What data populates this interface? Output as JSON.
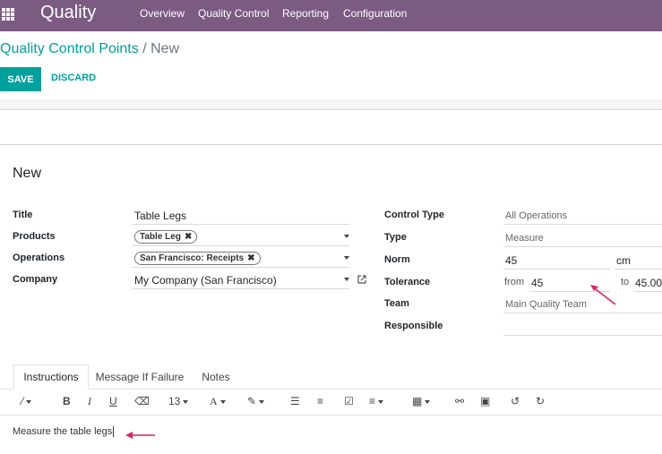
{
  "navbar": {
    "brand": "Quality",
    "menu": [
      "Overview",
      "Quality Control",
      "Reporting",
      "Configuration"
    ]
  },
  "breadcrumb": {
    "parent": "Quality Control Points",
    "separator": "/",
    "current": "New"
  },
  "buttons": {
    "save": "SAVE",
    "discard": "DISCARD"
  },
  "form": {
    "title": "New",
    "left": {
      "title_label": "Title",
      "title_value": "Table Legs",
      "products_label": "Products",
      "products_tag": "Table Leg",
      "operations_label": "Operations",
      "operations_tag": "San Francisco: Receipts",
      "company_label": "Company",
      "company_value": "My Company (San Francisco)"
    },
    "right": {
      "control_type_label": "Control Type",
      "control_type_value": "All Operations",
      "type_label": "Type",
      "type_value": "Measure",
      "norm_label": "Norm",
      "norm_value": "45",
      "norm_unit": "cm",
      "tolerance_label": "Tolerance",
      "tolerance_from_label": "from",
      "tolerance_from": "45",
      "tolerance_to_label": "to",
      "tolerance_to": "45.00",
      "team_label": "Team",
      "team_value": "Main Quality Team",
      "responsible_label": "Responsible",
      "responsible_value": ""
    }
  },
  "tabs": [
    "Instructions",
    "Message If Failure",
    "Notes"
  ],
  "toolbar": {
    "font_size": "13"
  },
  "editor": {
    "text": "Measure the table legs"
  },
  "colors": {
    "navbar": "#7c5b83",
    "accent": "#00a09d",
    "annotation_arrow": "#e0245e"
  }
}
